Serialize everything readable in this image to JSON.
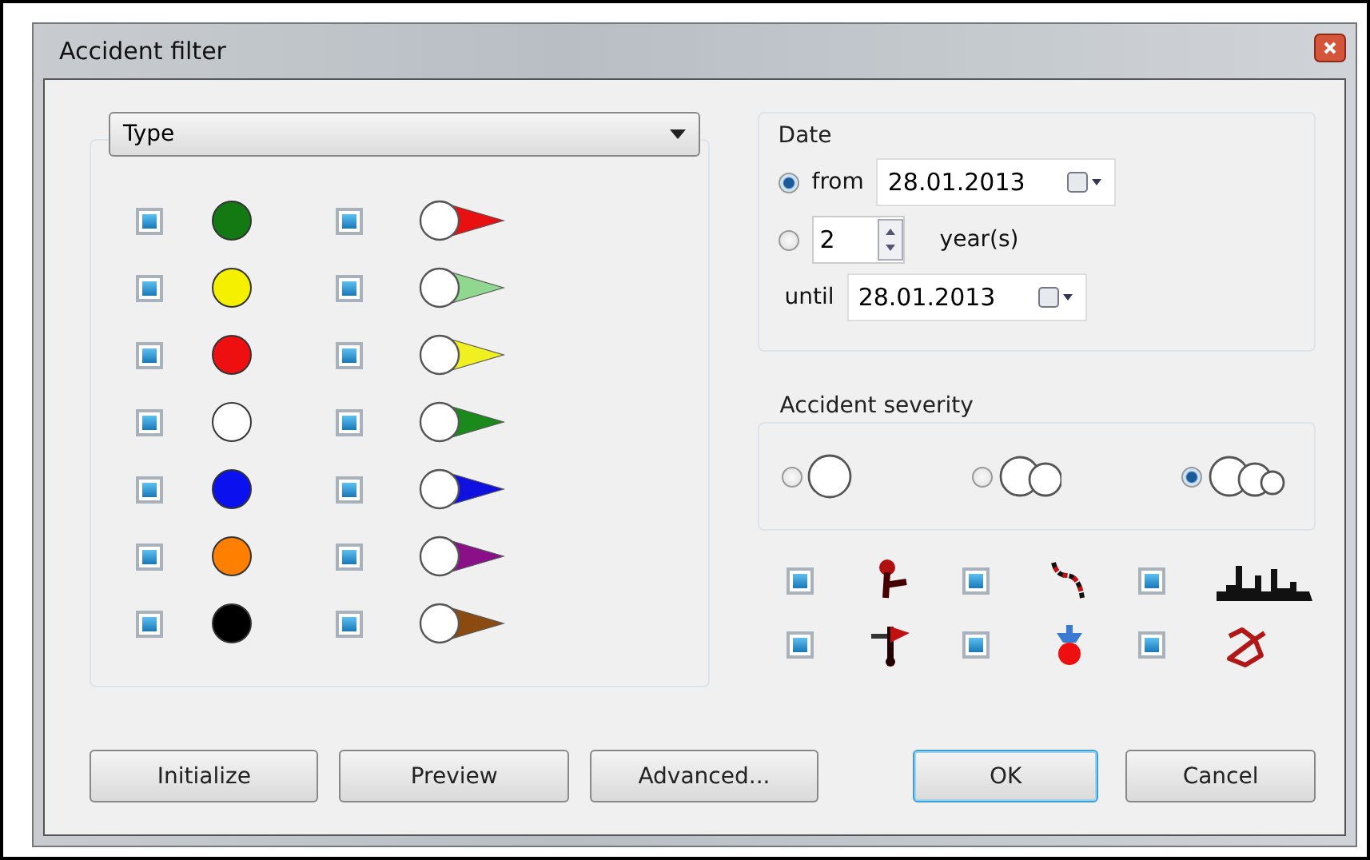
{
  "window": {
    "title": "Accident filter"
  },
  "type_select": {
    "value": "Type"
  },
  "type_rows": [
    {
      "dot": {
        "checked": true,
        "color": "#137a13"
      },
      "pin": {
        "checked": true,
        "color": "#e81010"
      }
    },
    {
      "dot": {
        "checked": true,
        "color": "#f5f000"
      },
      "pin": {
        "checked": true,
        "color": "#90d890"
      }
    },
    {
      "dot": {
        "checked": true,
        "color": "#ee1010"
      },
      "pin": {
        "checked": true,
        "color": "#f0f020"
      }
    },
    {
      "dot": {
        "checked": true,
        "color": "#ffffff"
      },
      "pin": {
        "checked": true,
        "color": "#1a8a1a"
      }
    },
    {
      "dot": {
        "checked": true,
        "color": "#0a10ee"
      },
      "pin": {
        "checked": true,
        "color": "#1010e0"
      }
    },
    {
      "dot": {
        "checked": true,
        "color": "#ff8000"
      },
      "pin": {
        "checked": true,
        "color": "#8a108a"
      }
    },
    {
      "dot": {
        "checked": true,
        "color": "#000000"
      },
      "pin": {
        "checked": true,
        "color": "#8a4a10"
      }
    }
  ],
  "date": {
    "title": "Date",
    "from": {
      "selected": true,
      "label": "from",
      "value": "28.01.2013"
    },
    "years": {
      "selected": false,
      "value": "2",
      "unit": "year(s)"
    },
    "until": {
      "label": "until",
      "value": "28.01.2013"
    }
  },
  "severity": {
    "title": "Accident severity",
    "options": [
      {
        "kind": "one",
        "selected": false
      },
      {
        "kind": "two",
        "selected": false
      },
      {
        "kind": "three",
        "selected": true
      }
    ]
  },
  "categories": [
    {
      "kind": "pedestrian",
      "checked": true
    },
    {
      "kind": "road",
      "checked": true
    },
    {
      "kind": "city",
      "checked": true
    },
    {
      "kind": "sign",
      "checked": true
    },
    {
      "kind": "figure",
      "checked": true
    },
    {
      "kind": "outline",
      "checked": true
    }
  ],
  "buttons": [
    {
      "label": "Initialize",
      "focused": false
    },
    {
      "label": "Preview",
      "focused": false
    },
    {
      "label": "Advanced...",
      "focused": false
    },
    {
      "label": "OK",
      "focused": true
    },
    {
      "label": "Cancel",
      "focused": false
    }
  ]
}
